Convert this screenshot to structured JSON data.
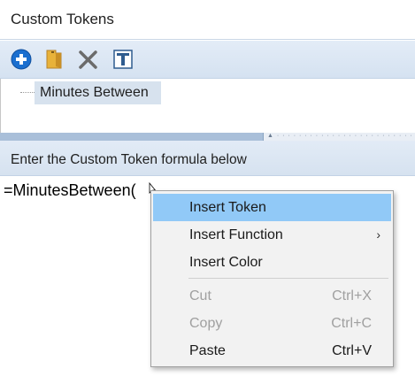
{
  "window": {
    "title": "Custom Tokens"
  },
  "toolbar": {
    "buttons": [
      {
        "icon": "add-icon",
        "name": "add"
      },
      {
        "icon": "folder-icon",
        "name": "folder"
      },
      {
        "icon": "delete-icon",
        "name": "delete"
      },
      {
        "icon": "text-token-icon",
        "name": "text"
      }
    ],
    "colors": {
      "add": "#1b6fcf",
      "folder": "#e8b23a",
      "delete": "#6b6b6b",
      "text": "#2f5c8f"
    }
  },
  "tree": {
    "items": [
      {
        "label": "Minutes Between",
        "selected": true
      }
    ]
  },
  "formula": {
    "header": "Enter the Custom Token formula below",
    "value": "=MinutesBetween("
  },
  "context_menu": {
    "items": [
      {
        "label": "Insert Token",
        "shortcut": "",
        "highlighted": true,
        "disabled": false
      },
      {
        "label": "Insert Function",
        "shortcut": "",
        "submenu": true,
        "disabled": false
      },
      {
        "label": "Insert Color",
        "shortcut": "",
        "disabled": false
      },
      {
        "label": "Cut",
        "shortcut": "Ctrl+X",
        "disabled": true
      },
      {
        "label": "Copy",
        "shortcut": "Ctrl+C",
        "disabled": true
      },
      {
        "label": "Paste",
        "shortcut": "Ctrl+V",
        "disabled": false
      }
    ],
    "submenu_arrow": "›",
    "highlight_color": "#91c9f7"
  }
}
